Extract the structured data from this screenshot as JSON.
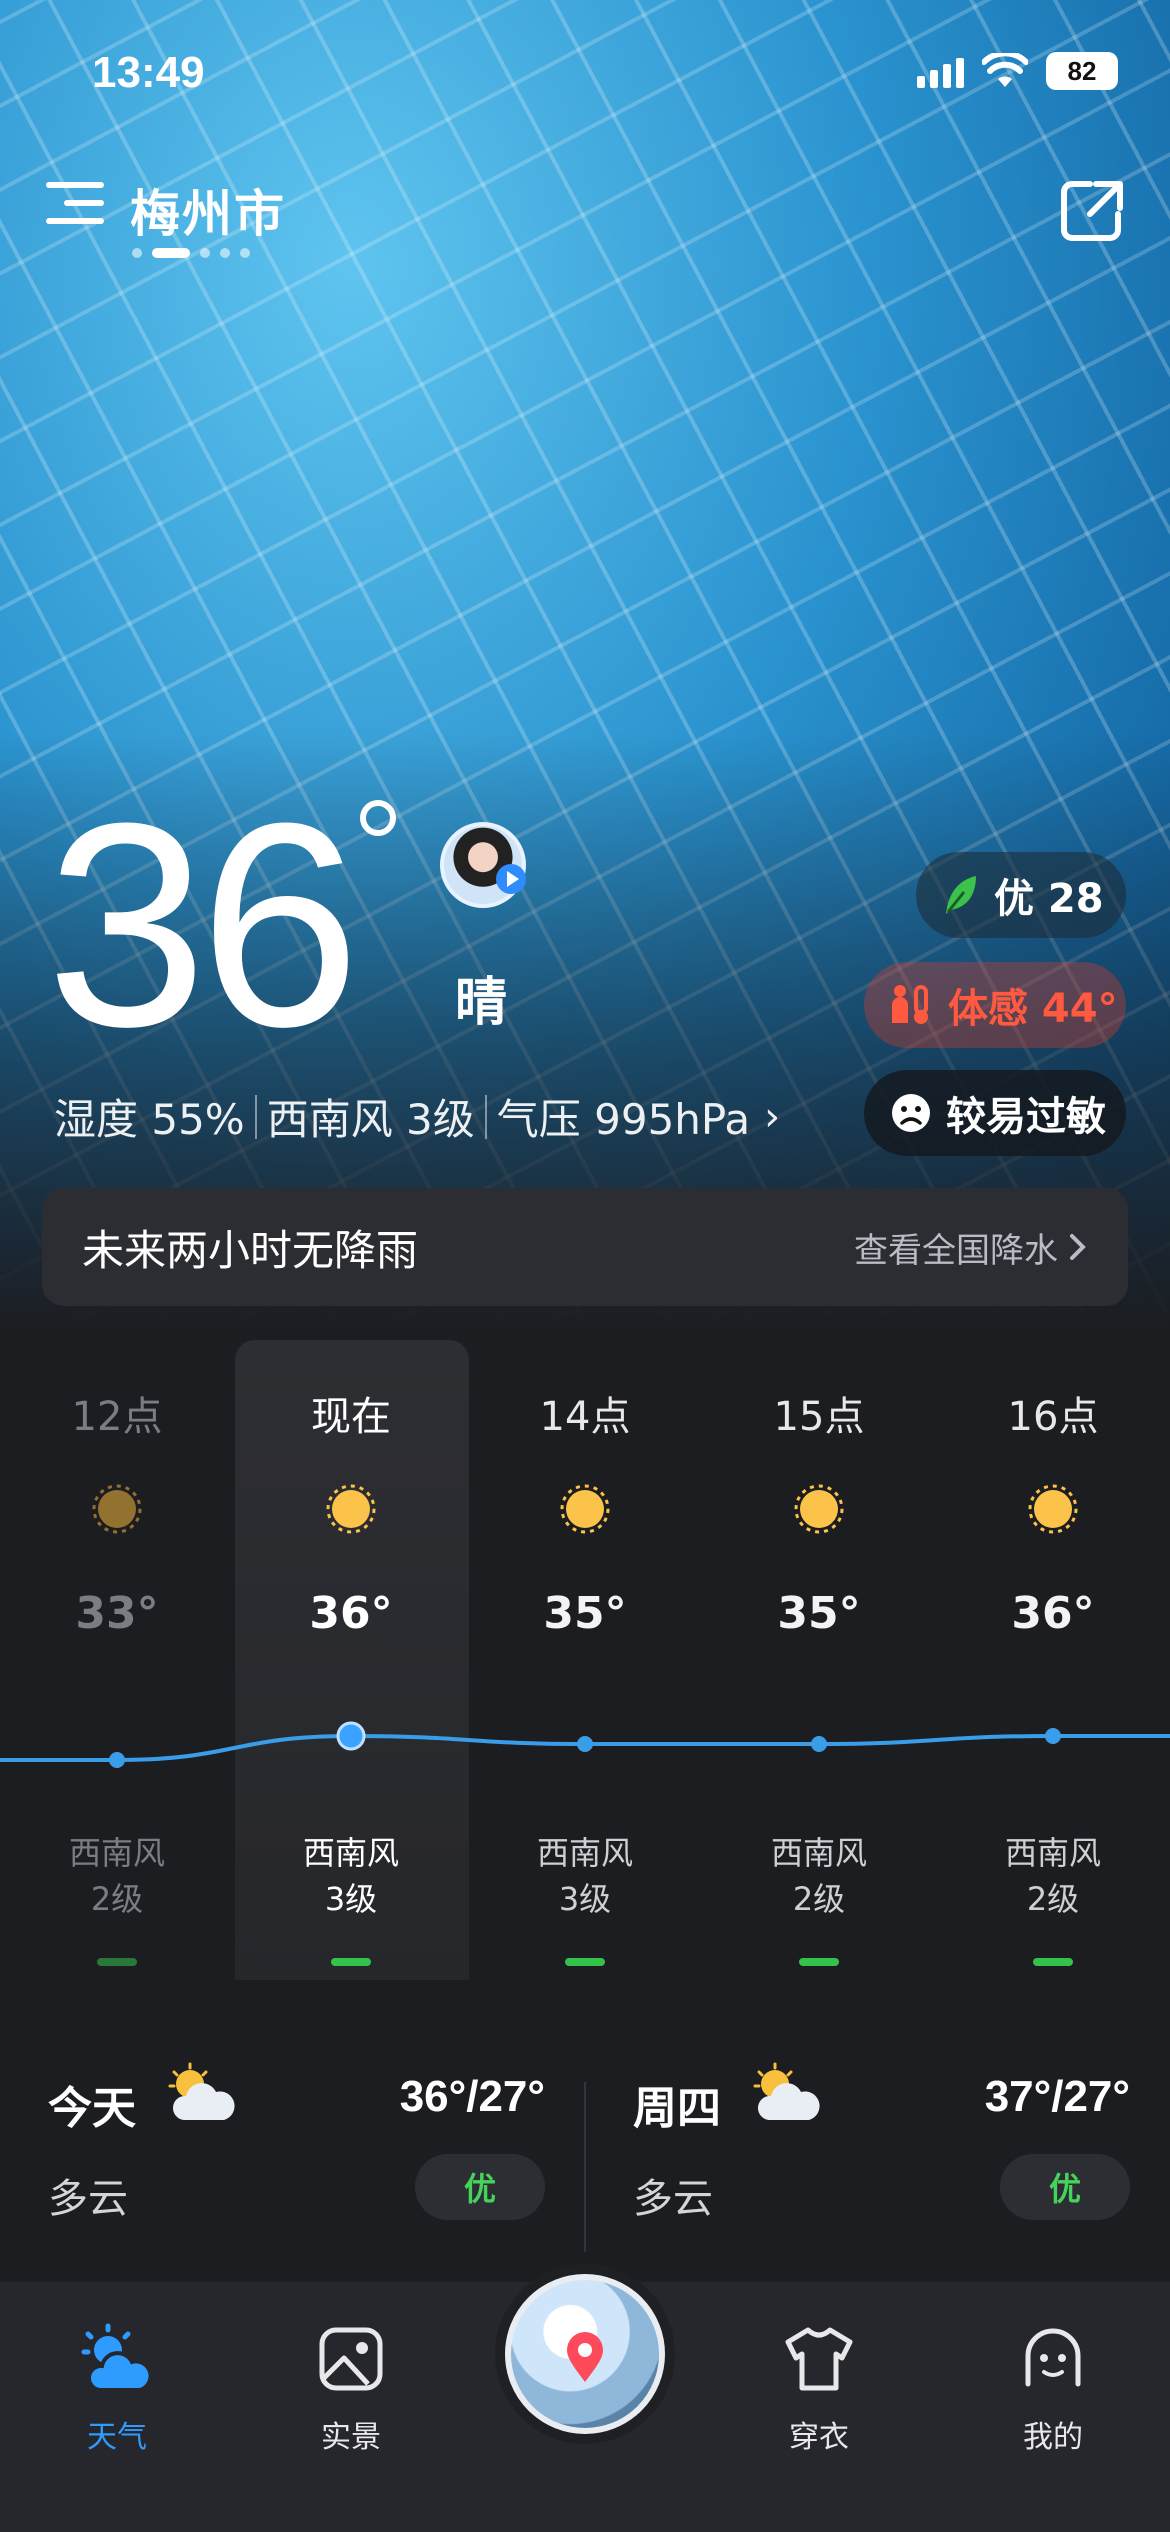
{
  "status_bar": {
    "time": "13:49",
    "battery": "82"
  },
  "header": {
    "city": "梅州市",
    "page_count": 5,
    "active_page": 1
  },
  "current": {
    "temperature": "36",
    "condition": "晴",
    "humidity": "湿度 55%",
    "wind": "西南风 3级",
    "pressure": "气压 995hPa",
    "chevron": "›"
  },
  "badges": {
    "aqi": "优 28",
    "feels_like": "体感 44°",
    "allergy": "较易过敏"
  },
  "rain_card": {
    "title": "未来两小时无降雨",
    "link": "查看全国降水"
  },
  "hourly": [
    {
      "label": "12点",
      "temp": "33°",
      "temp_value": 33,
      "wind_dir": "西南风",
      "wind_level": "2级",
      "state": "past"
    },
    {
      "label": "现在",
      "temp": "36°",
      "temp_value": 36,
      "wind_dir": "西南风",
      "wind_level": "3级",
      "state": "now"
    },
    {
      "label": "14点",
      "temp": "35°",
      "temp_value": 35,
      "wind_dir": "西南风",
      "wind_level": "3级",
      "state": "future"
    },
    {
      "label": "15点",
      "temp": "35°",
      "temp_value": 35,
      "wind_dir": "西南风",
      "wind_level": "2级",
      "state": "future"
    },
    {
      "label": "16点",
      "temp": "36°",
      "temp_value": 36,
      "wind_dir": "西南风",
      "wind_level": "2级",
      "state": "future"
    }
  ],
  "daily": [
    {
      "name": "今天",
      "icon": "partly-cloudy-icon",
      "temp": "36°/27°",
      "condition": "多云",
      "aqi": "优"
    },
    {
      "name": "周四",
      "icon": "partly-cloudy-icon",
      "temp": "37°/27°",
      "condition": "多云",
      "aqi": "优"
    }
  ],
  "tabs": [
    {
      "label": "天气",
      "icon": "weather-icon",
      "active": true
    },
    {
      "label": "实景",
      "icon": "photo-icon",
      "active": false
    },
    {
      "label": "",
      "icon": "map-pin-globe-icon",
      "active": false
    },
    {
      "label": "穿衣",
      "icon": "shirt-icon",
      "active": false
    },
    {
      "label": "我的",
      "icon": "profile-face-icon",
      "active": false
    }
  ],
  "colors": {
    "accent_blue": "#2e9bff",
    "aqi_green": "#46d35b",
    "feels_red": "#ff5a40",
    "background": "#1c1d21"
  }
}
